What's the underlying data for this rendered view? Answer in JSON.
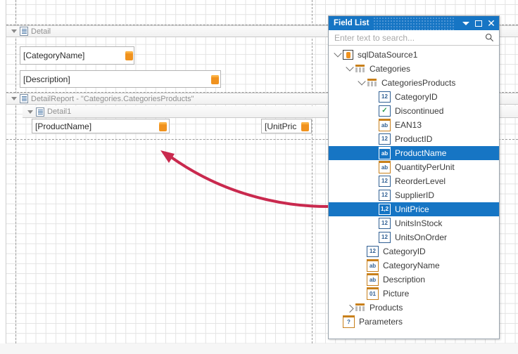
{
  "designer": {
    "bands": [
      {
        "label": "Detail",
        "icon": "band-detail-icon"
      },
      {
        "label": "DetailReport - \"Categories.CategoriesProducts\"",
        "icon": "band-detailreport-icon"
      },
      {
        "label": "Detail1",
        "icon": "band-detail1-icon"
      }
    ],
    "controls": [
      {
        "text": "[CategoryName]",
        "marker": "database-field-marker"
      },
      {
        "text": "[Description]",
        "marker": "database-field-marker"
      },
      {
        "text": "[ProductName]",
        "marker": "database-field-marker"
      },
      {
        "text": "[UnitPric",
        "marker": "database-field-marker"
      }
    ],
    "annotation": {
      "name": "drag-arrow",
      "color": "#c9294e"
    }
  },
  "field_list": {
    "title": "Field List",
    "title_buttons": [
      {
        "name": "dropdown-menu-button",
        "glyph": "chevron-down-icon"
      },
      {
        "name": "maximize-button",
        "glyph": "maximize-icon"
      },
      {
        "name": "close-button",
        "glyph": "close-icon"
      }
    ],
    "search": {
      "placeholder": "Enter text to search...",
      "value": "",
      "icon": "search-icon"
    },
    "tree": [
      {
        "label": "sqlDataSource1",
        "depth": 0,
        "icon": "datasource-icon",
        "expander": "expanded",
        "selected": false
      },
      {
        "label": "Categories",
        "depth": 1,
        "icon": "table-icon",
        "expander": "expanded",
        "selected": false
      },
      {
        "label": "CategoriesProducts",
        "depth": 2,
        "icon": "table-icon",
        "expander": "expanded",
        "selected": false
      },
      {
        "label": "CategoryID",
        "depth": 3,
        "icon": "integer-icon",
        "expander": "none",
        "selected": false,
        "glyph": "12"
      },
      {
        "label": "Discontinued",
        "depth": 3,
        "icon": "boolean-icon",
        "expander": "none",
        "selected": false,
        "glyph": "✓"
      },
      {
        "label": "EAN13",
        "depth": 3,
        "icon": "string-icon",
        "expander": "none",
        "selected": false,
        "glyph": "ab"
      },
      {
        "label": "ProductID",
        "depth": 3,
        "icon": "integer-icon",
        "expander": "none",
        "selected": false,
        "glyph": "12"
      },
      {
        "label": "ProductName",
        "depth": 3,
        "icon": "string-icon",
        "expander": "none",
        "selected": true,
        "glyph": "ab"
      },
      {
        "label": "QuantityPerUnit",
        "depth": 3,
        "icon": "string-icon",
        "expander": "none",
        "selected": false,
        "glyph": "ab"
      },
      {
        "label": "ReorderLevel",
        "depth": 3,
        "icon": "integer-icon",
        "expander": "none",
        "selected": false,
        "glyph": "12"
      },
      {
        "label": "SupplierID",
        "depth": 3,
        "icon": "integer-icon",
        "expander": "none",
        "selected": false,
        "glyph": "12"
      },
      {
        "label": "UnitPrice",
        "depth": 3,
        "icon": "decimal-icon",
        "expander": "none",
        "selected": true,
        "glyph": "1,2"
      },
      {
        "label": "UnitsInStock",
        "depth": 3,
        "icon": "integer-icon",
        "expander": "none",
        "selected": false,
        "glyph": "12"
      },
      {
        "label": "UnitsOnOrder",
        "depth": 3,
        "icon": "integer-icon",
        "expander": "none",
        "selected": false,
        "glyph": "12"
      },
      {
        "label": "CategoryID",
        "depth": 2,
        "icon": "integer-icon",
        "expander": "none",
        "selected": false,
        "glyph": "12"
      },
      {
        "label": "CategoryName",
        "depth": 2,
        "icon": "string-icon",
        "expander": "none",
        "selected": false,
        "glyph": "ab"
      },
      {
        "label": "Description",
        "depth": 2,
        "icon": "string-icon",
        "expander": "none",
        "selected": false,
        "glyph": "ab"
      },
      {
        "label": "Picture",
        "depth": 2,
        "icon": "binary-icon",
        "expander": "none",
        "selected": false,
        "glyph": "01"
      },
      {
        "label": "Products",
        "depth": 1,
        "icon": "table-icon",
        "expander": "collapsed",
        "selected": false
      },
      {
        "label": "Parameters",
        "depth": 0,
        "icon": "parameters-icon",
        "expander": "none",
        "selected": false,
        "glyph": "?"
      }
    ]
  },
  "colors": {
    "accent": "#1675c4",
    "arrow": "#c9294e",
    "marker": "#f0921e",
    "icon_orange": "#c8801b",
    "icon_blue": "#2f5f93"
  }
}
